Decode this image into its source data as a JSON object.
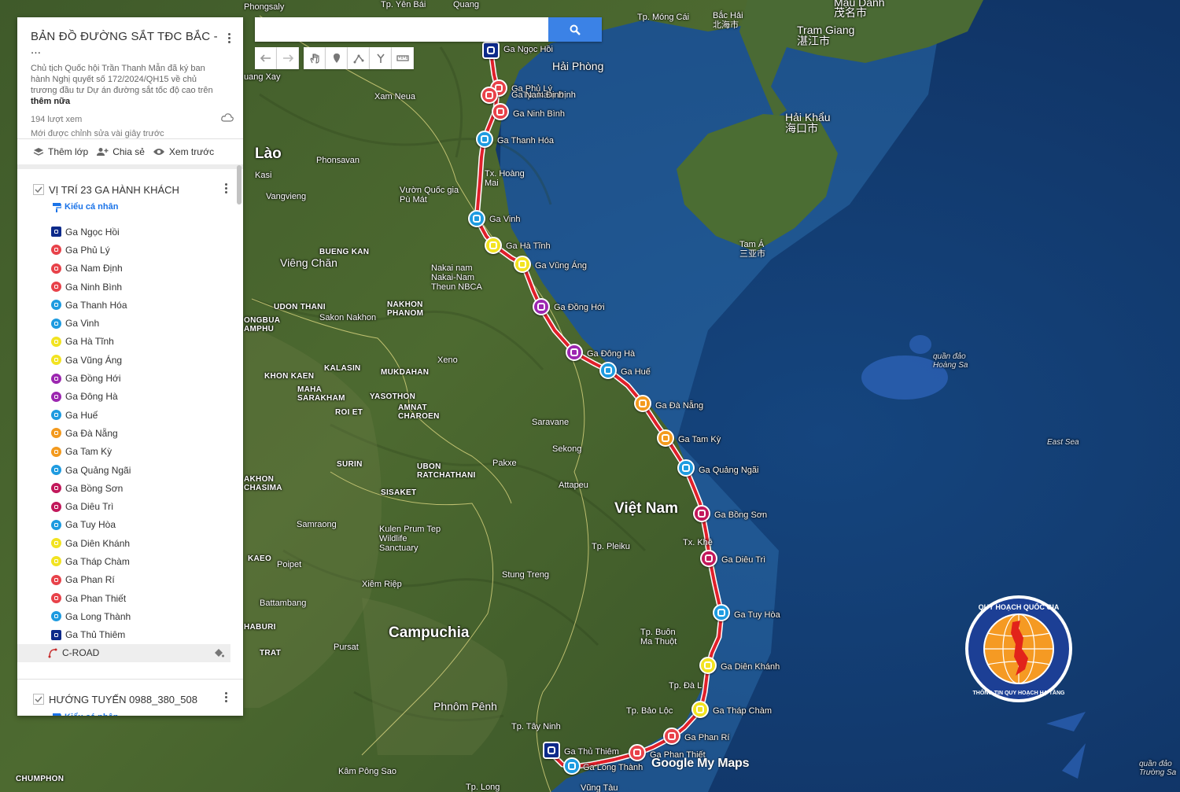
{
  "search": {
    "placeholder": ""
  },
  "toolbar": {
    "buttons": [
      {
        "name": "undo-icon"
      },
      {
        "name": "redo-icon"
      },
      {
        "name": "hand-icon"
      },
      {
        "name": "marker-icon"
      },
      {
        "name": "draw-line-icon"
      },
      {
        "name": "directions-icon"
      },
      {
        "name": "ruler-icon"
      }
    ]
  },
  "panel": {
    "title": "BẢN ĐỒ ĐƯỜNG SẮT TĐC BẮC - ...",
    "description": "Chủ tịch Quốc hội Trần Thanh Mẫn đã ký ban hành Nghị quyết số 172/2024/QH15 về chủ trương đầu tư Dự án đường sắt tốc độ cao trên",
    "more": "thêm nữa",
    "views": "194 lượt xem",
    "edited": "Mới được chỉnh sửa vài giây trước",
    "actions": {
      "add_layer": "Thêm lớp",
      "share": "Chia sẻ",
      "preview": "Xem trước"
    }
  },
  "layer1": {
    "title": "VỊ TRÍ 23 GA HÀNH KHÁCH",
    "style": "Kiểu cá nhân",
    "items": [
      {
        "label": "Ga Ngọc Hồi",
        "color": "#0d2a8a",
        "type": "train"
      },
      {
        "label": "Ga Phủ Lý",
        "color": "#e8424a",
        "type": "dot"
      },
      {
        "label": "Ga Nam Định",
        "color": "#e8424a",
        "type": "dot"
      },
      {
        "label": "Ga Ninh Bình",
        "color": "#e8424a",
        "type": "dot"
      },
      {
        "label": "Ga Thanh Hóa",
        "color": "#1e9be0",
        "type": "dot"
      },
      {
        "label": "Ga Vinh",
        "color": "#1e9be0",
        "type": "dot"
      },
      {
        "label": "Ga Hà Tĩnh",
        "color": "#f2e321",
        "type": "dot"
      },
      {
        "label": "Ga Vũng Áng",
        "color": "#f2e321",
        "type": "dot"
      },
      {
        "label": "Ga Đồng Hới",
        "color": "#9c27b0",
        "type": "dot"
      },
      {
        "label": "Ga Đông Hà",
        "color": "#9c27b0",
        "type": "dot"
      },
      {
        "label": "Ga Huế",
        "color": "#1e9be0",
        "type": "dot"
      },
      {
        "label": "Ga Đà Nẵng",
        "color": "#f39a1e",
        "type": "dot"
      },
      {
        "label": "Ga Tam Kỳ",
        "color": "#f39a1e",
        "type": "dot"
      },
      {
        "label": "Ga Quảng Ngãi",
        "color": "#1e9be0",
        "type": "dot"
      },
      {
        "label": "Ga Bồng Sơn",
        "color": "#c2185b",
        "type": "dot"
      },
      {
        "label": "Ga Diêu Trì",
        "color": "#c2185b",
        "type": "dot"
      },
      {
        "label": "Ga Tuy Hòa",
        "color": "#1e9be0",
        "type": "dot"
      },
      {
        "label": "Ga Diên Khánh",
        "color": "#f2e321",
        "type": "dot"
      },
      {
        "label": "Ga Tháp Chàm",
        "color": "#f2e321",
        "type": "dot"
      },
      {
        "label": "Ga Phan Rí",
        "color": "#e8424a",
        "type": "dot"
      },
      {
        "label": "Ga Phan Thiết",
        "color": "#e8424a",
        "type": "dot"
      },
      {
        "label": "Ga Long Thành",
        "color": "#1e9be0",
        "type": "dot"
      },
      {
        "label": "Ga Thủ Thiêm",
        "color": "#0d2a8a",
        "type": "train"
      }
    ],
    "road": "C-ROAD"
  },
  "layer2": {
    "title": "HƯỚNG TUYẾN 0988_380_508",
    "style": "Kiểu cá nhân"
  },
  "map_labels": {
    "phongsaly": "Phongsaly",
    "yen_bai": "Tp. Yên Bái",
    "quang": "Quang",
    "mong_cai": "Tp. Móng Cái",
    "bac_hai": "Bắc Hải",
    "bac_hai_cn": "北海市",
    "tram_giang": "Tram Giang",
    "tram_giang_cn": "湛江市",
    "mau_danh": "Mậu Danh",
    "mau_danh_cn": "茂名市",
    "hai_phong": "Hải Phòng",
    "nam_dinh": "Tp. Nam Định",
    "hai_khau": "Hải Khẩu",
    "hai_khau_cn": "海口市",
    "xam_neua": "Xam Neua",
    "luang": "uang Xay",
    "lao": "Lào",
    "phonsavan": "Phonsavan",
    "kasi": "Kasi",
    "vangvieng": "Vangvieng",
    "vuon_quoc_gia": "Vườn Quốc gia Pù Mát",
    "hoang_mai": "Tx. Hoàng Mai",
    "tam_a": "Tam Á",
    "tam_a_cn": "三亚市",
    "bueng_kan": "BUENG KAN",
    "vieng_chan": "Viêng Chăn",
    "nakai": "Nakai nam Nakai-Nam Theun NBCA",
    "udon": "UDON THANI",
    "nakhon": "NAKHON PHANOM",
    "sakon": "Sakon Nakhon",
    "ongbua": "ONGBUA AMPHU",
    "kalasin": "KALASIN",
    "khon_kaen": "KHON KAEN",
    "mukdahan": "MUKDAHAN",
    "xeno": "Xeno",
    "maha": "MAHA SARAKHAM",
    "roi_et": "ROI ET",
    "yasothon": "YASOTHON",
    "amnat": "AMNAT CHAROEN",
    "saravane": "Saravane",
    "sekong": "Sekong",
    "hoang_sa": "quần đảo Hoàng Sa",
    "east_sea": "East Sea",
    "surin": "SURIN",
    "ubon": "UBON RATCHATHANI",
    "pakxe": "Pakxe",
    "attapeu": "Attapeu",
    "viet_nam": "Việt Nam",
    "sisaket": "SISAKET",
    "khorat": "AKHON CHASIMA",
    "kulen": "Kulen Prum Tep Wildlife Sanctuary",
    "samraong": "Samraong",
    "pleiku": "Tp. Pleiku",
    "stung": "Stung Treng",
    "kaeo": "KAEO",
    "poipet": "Poipet",
    "xiem_riep": "Xiêm Riệp",
    "battambang": "Battambang",
    "buon_ma": "Tp. Buôn Ma Thuột",
    "haburi": "HABURI",
    "campuchia": "Campuchia",
    "pursat": "Pursat",
    "trat": "TRAT",
    "phnom_penh": "Phnôm Pênh",
    "tay_ninh": "Tp. Tây Ninh",
    "bao_loc": "Tp. Bảo Lộc",
    "kampong": "Kâm Pông Sao",
    "chumphon": "CHUMPHON",
    "long": "Tp. Long",
    "vung_tau": "Vũng Tàu",
    "truong_sa": "quần đảo Trường Sa",
    "tx_khe": "Tx. Khê",
    "da_lat": "Tp. Đà L"
  },
  "stations": [
    {
      "label": "Ga Ngọc Hồi",
      "color": "#0d2a8a",
      "type": "train"
    },
    {
      "label": "Ga Phủ Lý",
      "color": "#e8424a"
    },
    {
      "label": "Ga Nam Định",
      "color": "#e8424a"
    },
    {
      "label": "Ga Ninh Bình",
      "color": "#e8424a"
    },
    {
      "label": "Ga Thanh Hóa",
      "color": "#1e9be0"
    },
    {
      "label": "Ga Vinh",
      "color": "#1e9be0"
    },
    {
      "label": "Ga Hà Tĩnh",
      "color": "#f2e321"
    },
    {
      "label": "Ga Vũng Áng",
      "color": "#f2e321"
    },
    {
      "label": "Ga Đồng Hới",
      "color": "#9c27b0"
    },
    {
      "label": "Ga Đông Hà",
      "color": "#9c27b0"
    },
    {
      "label": "Ga Huế",
      "color": "#1e9be0"
    },
    {
      "label": "Ga Đà Nẵng",
      "color": "#f39a1e"
    },
    {
      "label": "Ga Tam Kỳ",
      "color": "#f39a1e"
    },
    {
      "label": "Ga Quảng Ngãi",
      "color": "#1e9be0"
    },
    {
      "label": "Ga Bồng Sơn",
      "color": "#c2185b"
    },
    {
      "label": "Ga Diêu Trì",
      "color": "#c2185b"
    },
    {
      "label": "Ga Tuy Hòa",
      "color": "#1e9be0"
    },
    {
      "label": "Ga Diên Khánh",
      "color": "#f2e321"
    },
    {
      "label": "Ga Tháp Chàm",
      "color": "#f2e321"
    },
    {
      "label": "Ga Phan Rí",
      "color": "#e8424a"
    },
    {
      "label": "Ga Phan Thiết",
      "color": "#e8424a"
    },
    {
      "label": "Ga Long Thành",
      "color": "#1e9be0"
    },
    {
      "label": "Ga Thủ Thiêm",
      "color": "#0d2a8a",
      "type": "train"
    }
  ],
  "logo": {
    "gmm": "Google My Maps",
    "seal_text": "QUY HOẠCH QUỐC GIA · THÔNG TIN QUY HOẠCH HẠ TẦNG"
  }
}
